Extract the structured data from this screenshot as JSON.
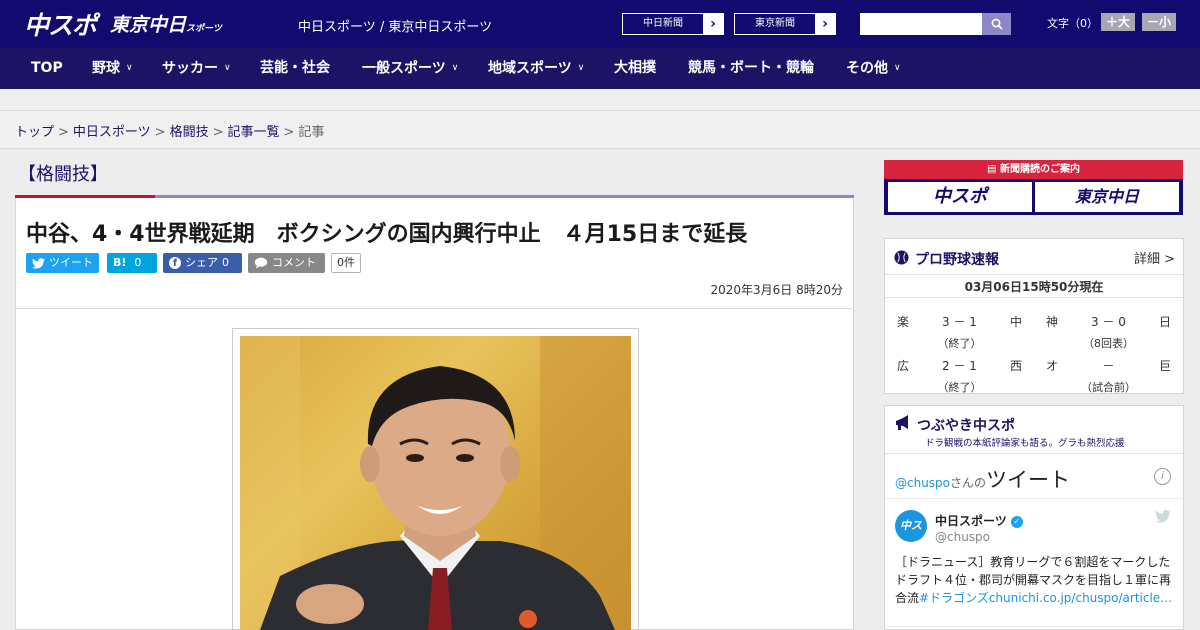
{
  "header": {
    "logo_main": "中スポ",
    "logo_sub_main": "東京中日",
    "logo_sub_small": "スポーツ",
    "site_name": "中日スポーツ / 東京中日スポーツ",
    "paper_links": [
      "中日新聞",
      "東京新聞"
    ],
    "search": {
      "placeholder": "",
      "value": ""
    },
    "font_size_label": "文字（0）",
    "font_larger": "＋大",
    "font_smaller": "－小"
  },
  "nav": {
    "items": [
      {
        "label": "TOP",
        "has_dropdown": false
      },
      {
        "label": "野球",
        "has_dropdown": true
      },
      {
        "label": "サッカー",
        "has_dropdown": true
      },
      {
        "label": "芸能・社会",
        "has_dropdown": false
      },
      {
        "label": "一般スポーツ",
        "has_dropdown": true
      },
      {
        "label": "地域スポーツ",
        "has_dropdown": true
      },
      {
        "label": "大相撲",
        "has_dropdown": false
      },
      {
        "label": "競馬・ボート・競輪",
        "has_dropdown": false
      },
      {
        "label": "その他",
        "has_dropdown": true
      }
    ]
  },
  "breadcrumb": {
    "items": [
      "トップ",
      "中日スポーツ",
      "格闘技",
      "記事一覧"
    ],
    "current": "記事",
    "separator": ">"
  },
  "article": {
    "category": "【格闘技】",
    "headline": "中谷、4・4世界戦延期　ボクシングの国内興行中止　４月15日まで延長",
    "share": {
      "twitter": "ツイート",
      "hatena": "B!",
      "hatena_count": "0",
      "facebook": "シェア",
      "facebook_count": "0",
      "comment": "コメント",
      "comment_count": "0件"
    },
    "date": "2020年3月6日 8時20分"
  },
  "sidebar": {
    "ad": {
      "title": "新聞購読のご案内",
      "button1": "中スポ",
      "button2": "東京中日"
    },
    "baseball": {
      "title": "プロ野球速報",
      "detail": "詳細 >",
      "time": "03月06日15時50分現在",
      "games": [
        {
          "team1": "楽",
          "score": "3 － 1",
          "team2": "中",
          "status": "（終了）"
        },
        {
          "team1": "神",
          "score": "3 － 0",
          "team2": "日",
          "status": "（8回表）"
        },
        {
          "team1": "広",
          "score": "2 － 1",
          "team2": "西",
          "status": "（終了）"
        },
        {
          "team1": "オ",
          "score": "－",
          "team2": "巨",
          "status": "（試合前）"
        }
      ]
    },
    "twitter": {
      "title": "つぶやき中スポ",
      "subtitle": "ドラ観戦の本紙評論家も語る。グラも熱烈応援",
      "timeline_handle": "@chuspo",
      "timeline_suffix": "さんの",
      "timeline_word": "ツイート",
      "tweet": {
        "name": "中日スポーツ",
        "handle": "@chuspo",
        "avatar_text": "中スポ",
        "text": "［ドラニュース］教育リーグで６割超をマークしたドラフト４位・郡司が開幕マスクを目指し１軍に再合流",
        "link": "#ドラゴンズchunichi.co.jp/chuspo/article…"
      }
    }
  }
}
